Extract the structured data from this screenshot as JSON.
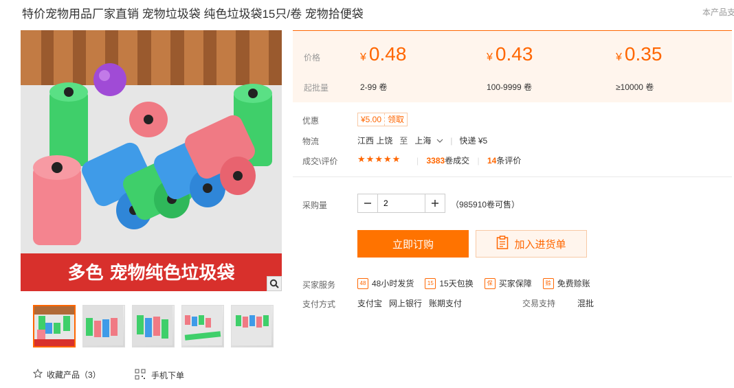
{
  "product": {
    "title": "特价宠物用品厂家直销 宠物垃圾袋 纯色垃圾袋15只/卷 宠物拾便袋",
    "title_right": "本产品支"
  },
  "gallery": {
    "banner_text": "多色 宠物纯色垃圾袋",
    "thumbnail_count": 5
  },
  "actions": {
    "favorite_label": "收藏产品（3）",
    "mobile_order_label": "手机下单"
  },
  "pricing": {
    "price_label": "价格",
    "min_qty_label": "起批量",
    "currency_symbol": "¥",
    "tiers": [
      {
        "price": "0.48",
        "range": "2-99 卷"
      },
      {
        "price": "0.43",
        "range": "100-9999 卷"
      },
      {
        "price": "0.35",
        "range": "≥10000 卷"
      }
    ]
  },
  "discount": {
    "label": "优惠",
    "coupon_value": "¥5.00",
    "coupon_action": "领取"
  },
  "logistics": {
    "label": "物流",
    "from": "江西 上饶",
    "to_word": "至",
    "to": "上海",
    "shipping": "快递 ¥5"
  },
  "reviews": {
    "label": "成交\\评价",
    "stars": 5,
    "deal_count": "3383",
    "deal_suffix": "卷成交",
    "review_count": "14",
    "review_suffix": "条评价"
  },
  "purchase": {
    "qty_label": "采购量",
    "qty_value": "2",
    "stock_text": "（985910卷可售）",
    "buy_label": "立即订购",
    "cart_label": "加入进货单"
  },
  "services": {
    "label": "买家服务",
    "items": [
      {
        "icon": "48",
        "label": "48小时发货"
      },
      {
        "icon": "15",
        "label": "15天包换"
      },
      {
        "icon": "保",
        "label": "买家保障"
      },
      {
        "icon": "赊",
        "label": "免费赊账"
      }
    ]
  },
  "payment": {
    "label": "支付方式",
    "methods": [
      "支付宝",
      "网上银行",
      "账期支付"
    ],
    "trade_label": "交易支持",
    "trade_value": "混批"
  },
  "colors": {
    "accent": "#ff6600",
    "buy_button": "#ff7300",
    "price_bg": "#fff5ed"
  }
}
